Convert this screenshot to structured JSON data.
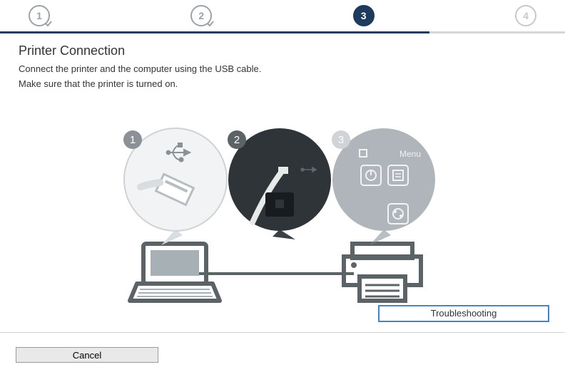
{
  "stepper": {
    "steps": [
      "1",
      "2",
      "3",
      "4"
    ],
    "current": 3,
    "progress_pct": 76
  },
  "title": "Printer Connection",
  "description_line1": "Connect the printer and the computer using the USB cable.",
  "description_line2": "Make sure that the printer is turned on.",
  "bubbles": {
    "b1": "1",
    "b2": "2",
    "b3": "3",
    "b3_menu_label": "Menu"
  },
  "troubleshooting_label": "Troubleshooting",
  "cancel_label": "Cancel"
}
